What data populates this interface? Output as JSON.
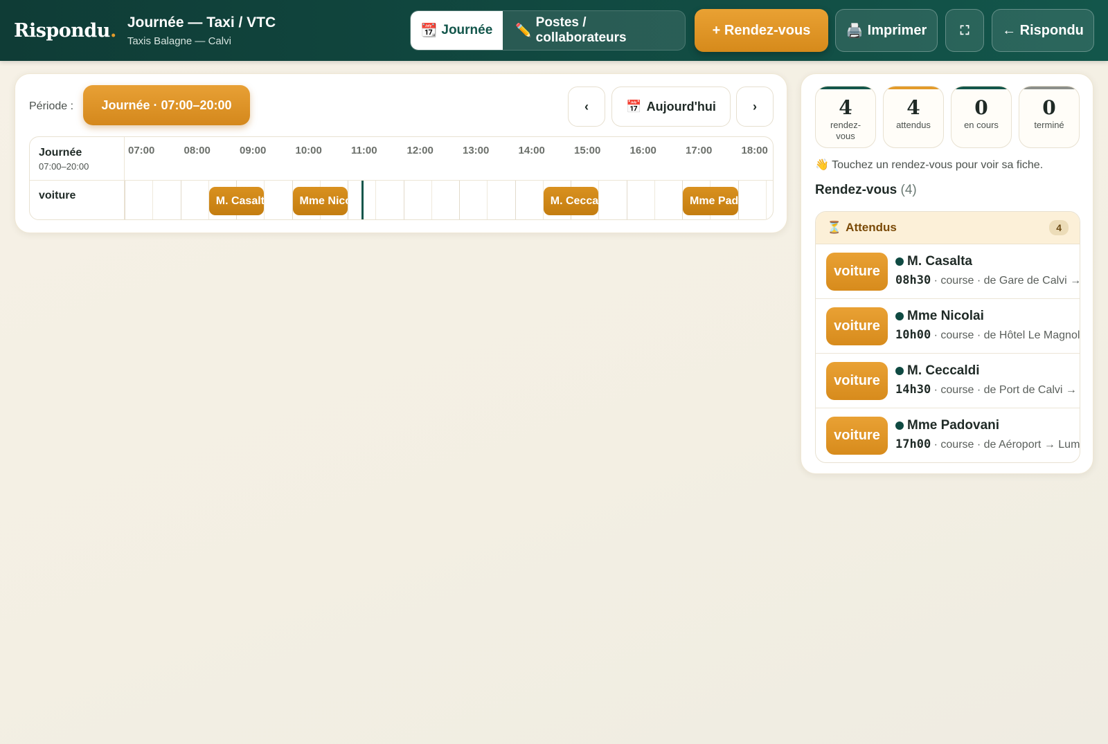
{
  "header": {
    "logo": "Rispondu",
    "logo_dot": ".",
    "title": "Journée — Taxi / VTC",
    "subtitle": "Taxis Balagne — Calvi",
    "tabs": [
      {
        "icon": "📆",
        "label": "Journée",
        "active": true
      },
      {
        "icon": "✏️",
        "label": "Postes / collaborateurs",
        "active": false
      }
    ],
    "new_appointment": "+ Rendez-vous",
    "print_icon": "🖨️",
    "print": "Imprimer",
    "fullscreen_icon": "⛶",
    "back": "← Rispondu"
  },
  "planner": {
    "periode_label": "Période :",
    "periode_value": "Journée · 07:00–20:00",
    "prev": "‹",
    "today_icon": "📅",
    "today": "Aujourd'hui",
    "next": "›",
    "day_title": "Journée",
    "day_range": "07:00–20:00",
    "hours": [
      "07:00",
      "08:00",
      "09:00",
      "10:00",
      "11:00",
      "12:00",
      "13:00",
      "14:00",
      "15:00",
      "16:00",
      "17:00",
      "18:00"
    ],
    "row_label": "voiture",
    "now": "11:15",
    "events": [
      {
        "label": "M. Casalta",
        "start": "08:30"
      },
      {
        "label": "Mme Nicolai",
        "start": "10:00"
      },
      {
        "label": "M. Ceccaldi",
        "start": "14:30"
      },
      {
        "label": "Mme Padovani",
        "start": "17:00"
      }
    ]
  },
  "stats": [
    {
      "value": "4",
      "label": "rendez-vous",
      "accent": "#13564b"
    },
    {
      "value": "4",
      "label": "attendus",
      "accent": "#e39b2a"
    },
    {
      "value": "0",
      "label": "en cours",
      "accent": "#13564b"
    },
    {
      "value": "0",
      "label": "terminé",
      "accent": "#8c8f8a"
    }
  ],
  "sidebar": {
    "hint": "👋 Touchez un rendez-vous pour voir sa fiche.",
    "section_title": "Rendez-vous",
    "section_count": "(4)",
    "group": {
      "icon": "⏳",
      "label": "Attendus",
      "count": "4",
      "items": [
        {
          "tag": "voiture",
          "name": "M. Casalta",
          "time": "08h30",
          "details": " · course · de Gare de Calvi → "
        },
        {
          "tag": "voiture",
          "name": "Mme Nicolai",
          "time": "10h00",
          "details": " · course · de Hôtel Le Magnolia"
        },
        {
          "tag": "voiture",
          "name": "M. Ceccaldi",
          "time": "14h30",
          "details": " · course · de Port de Calvi → "
        },
        {
          "tag": "voiture",
          "name": "Mme Padovani",
          "time": "17h00",
          "details": " · course · de Aéroport → Lumio"
        }
      ]
    }
  }
}
